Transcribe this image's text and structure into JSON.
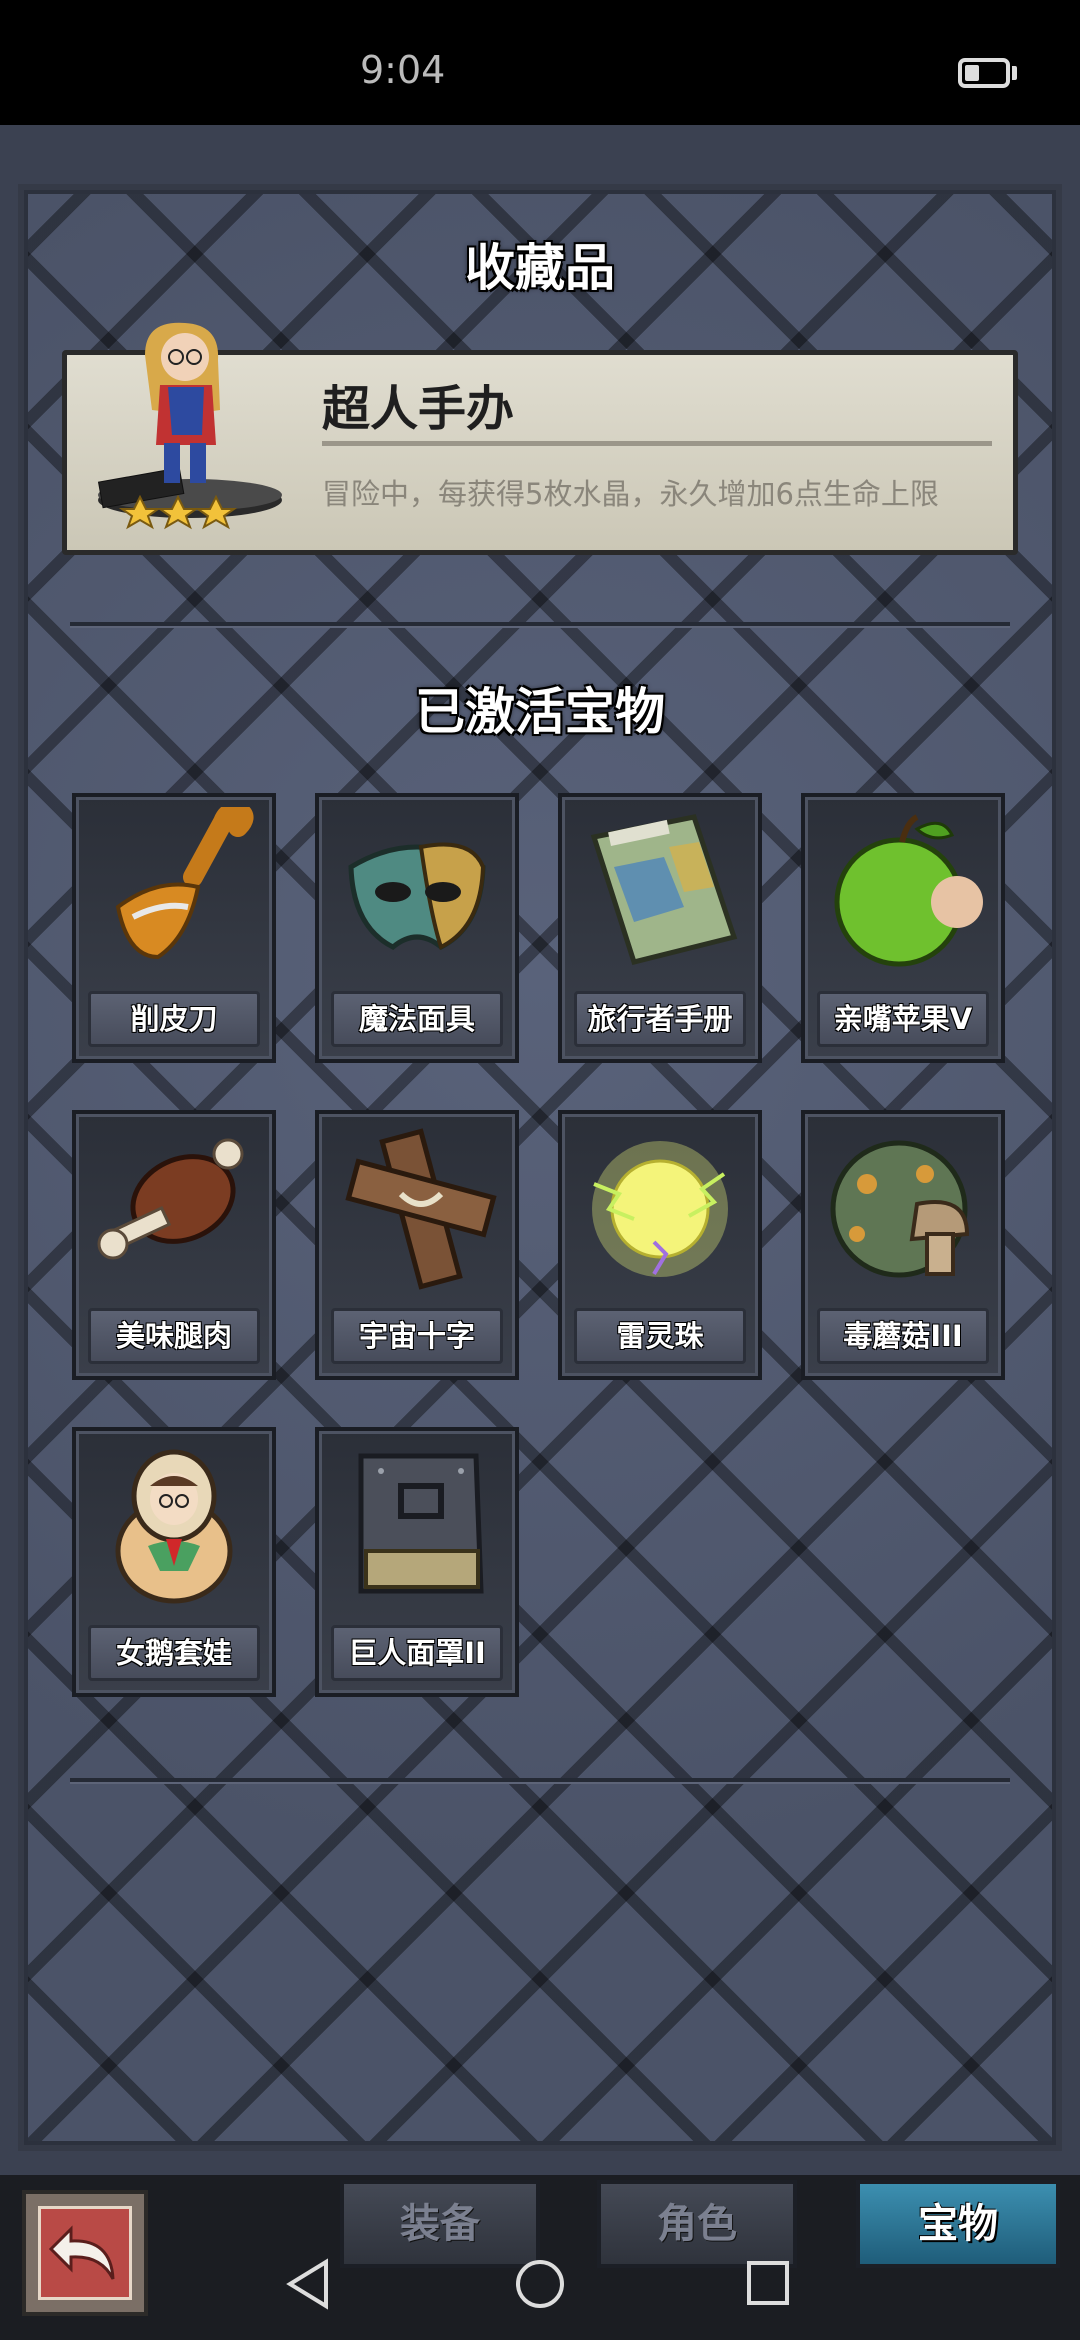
{
  "status_bar": {
    "time": "9:04"
  },
  "collection": {
    "title": "收藏品",
    "featured": {
      "name": "超人手办",
      "stars": 3,
      "description": "冒险中，每获得5枚水晶，永久增加6点生命上限"
    }
  },
  "treasures": {
    "title": "已激活宝物",
    "items": [
      {
        "label": "削皮刀",
        "icon": "peeler-icon"
      },
      {
        "label": "魔法面具",
        "icon": "mask-icon"
      },
      {
        "label": "旅行者手册",
        "icon": "map-book-icon"
      },
      {
        "label": "亲嘴苹果V",
        "icon": "apple-icon"
      },
      {
        "label": "美味腿肉",
        "icon": "meat-icon"
      },
      {
        "label": "宇宙十字",
        "icon": "cross-icon"
      },
      {
        "label": "雷灵珠",
        "icon": "thunder-orb-icon"
      },
      {
        "label": "毒蘑菇III",
        "icon": "mushroom-icon"
      },
      {
        "label": "女鹅套娃",
        "icon": "nesting-doll-icon"
      },
      {
        "label": "巨人面罩II",
        "icon": "giant-mask-icon"
      }
    ]
  },
  "bottom_tabs": [
    {
      "label": "装备",
      "active": false
    },
    {
      "label": "角色",
      "active": false
    },
    {
      "label": "宝物",
      "active": true
    }
  ],
  "colors": {
    "accent_tab": "#2b78a0",
    "panel": "#4a5266",
    "card": "#dcd9cb"
  }
}
